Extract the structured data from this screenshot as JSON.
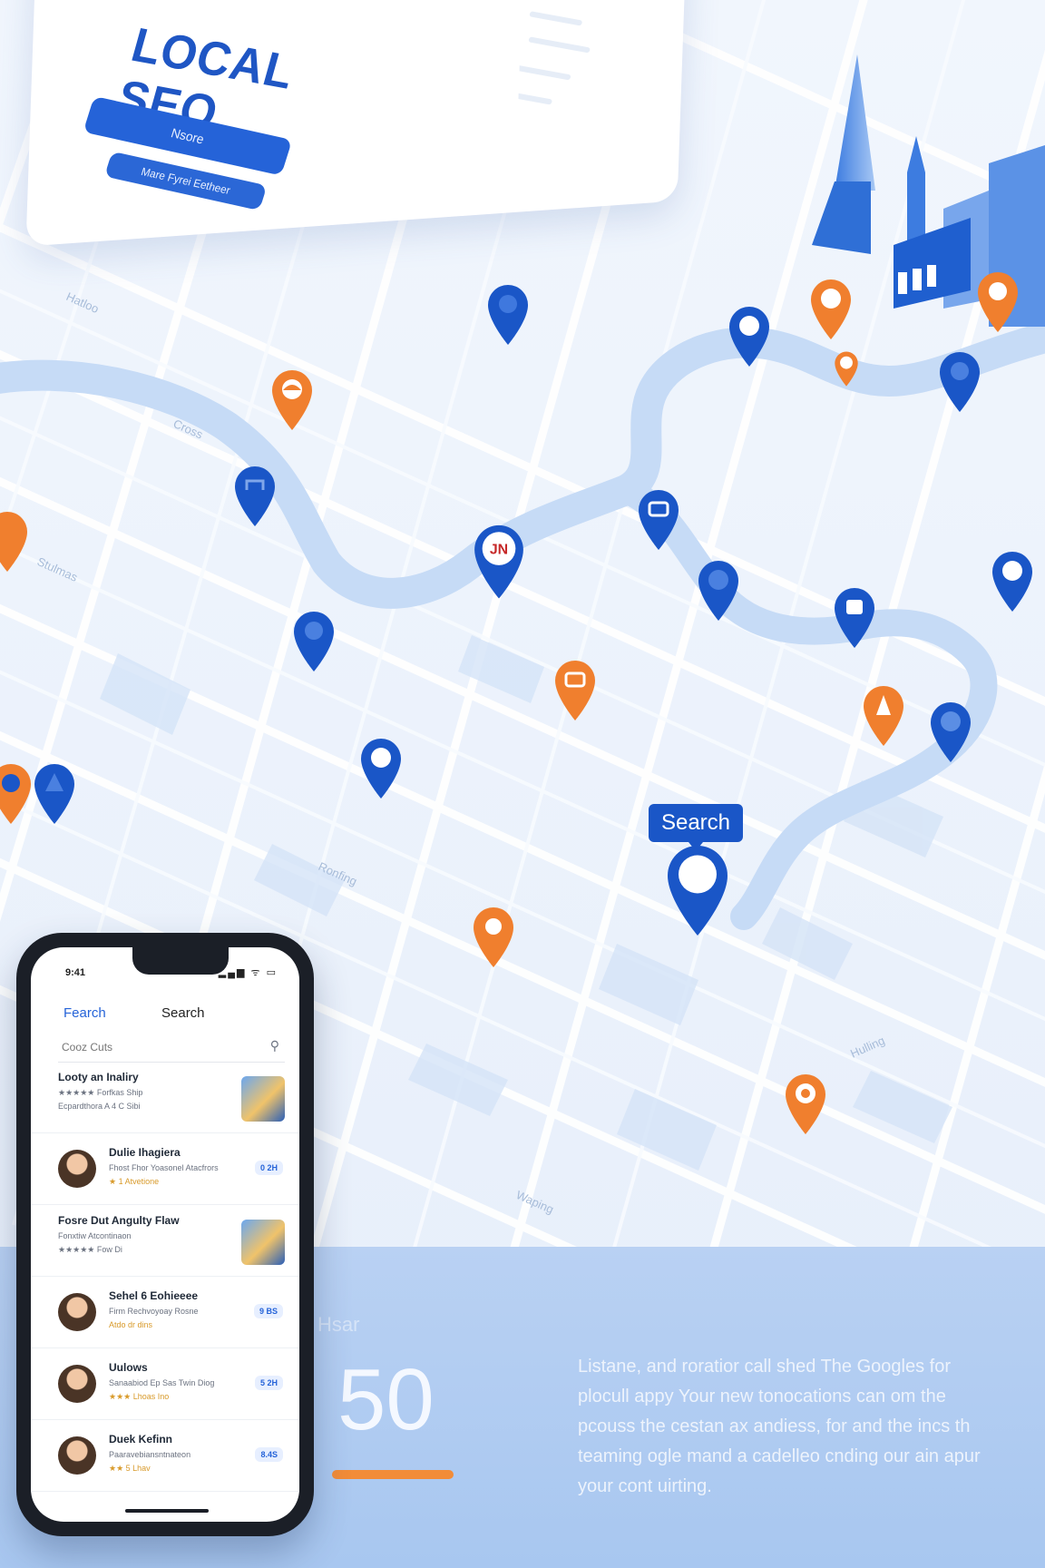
{
  "card": {
    "title_line1": "LOCAL",
    "title_line2": "SEO",
    "primary_button": "Nsore",
    "secondary_button": "Mare Fyrei Eetheer"
  },
  "map": {
    "search_label": "Search",
    "street_labels": [
      "Hatloo",
      "Cross",
      "Stulmas",
      "Ronfing",
      "Waping",
      "Hulling"
    ]
  },
  "stats": {
    "caption": "Hsar",
    "number": "50",
    "description_lines": [
      "Listane, and roratior call shed The Googles for",
      "plocull appy Your new tonocations can om the",
      "pcouss the cestan ax andiess, for and the incs th",
      "teaming ogle mand a cadelleo cnding our ain apur",
      "your cont uirting."
    ]
  },
  "phone": {
    "status_time": "9:41",
    "status_icons": "▂▄▆ ᯤ ▭",
    "nav_back": "Fearch",
    "nav_title": "Search",
    "search_placeholder": "Cooz Cuts",
    "listings": [
      {
        "kind": "a",
        "name": "Looty an Inaliry",
        "meta1": "★★★★★ Forfkas Ship",
        "meta2": "Ecpardthora A 4 C Sibi"
      },
      {
        "kind": "b",
        "name": "Dulie Ihagiera",
        "meta1": "Fhost Fhor Yoasonel Atacfrors",
        "meta2": "★ 1 Atvetione",
        "badge": "0 2H"
      },
      {
        "kind": "a",
        "name": "Fosre Dut Angulty Flaw",
        "meta1": "Fonxtiw Atcontinaon",
        "meta2": "★★★★★ Fow Di"
      },
      {
        "kind": "b",
        "name": "Sehel 6 Eohieeee",
        "meta1": "Firm Rechvoyoay Rosne",
        "meta2": "Atdo dr dins",
        "badge": "9 BS"
      },
      {
        "kind": "b",
        "name": "Uulows",
        "meta1": "Sanaabiod Ep Sas Twin Diog",
        "meta2": "★★★ Lhoas Ino",
        "badge": "5 2H"
      },
      {
        "kind": "b",
        "name": "Duek Kefinn",
        "meta1": "Paaravebiansntnateon",
        "meta2": "★★ 5 Lhav",
        "badge": "8.4S"
      }
    ]
  },
  "colors": {
    "blue_pin": "#1a56c7",
    "orange_pin": "#f07f2e",
    "map_water": "#c6dbf6",
    "map_road": "#ffffff",
    "band": "#b0ccf2",
    "accent_bar": "#f28c38"
  }
}
